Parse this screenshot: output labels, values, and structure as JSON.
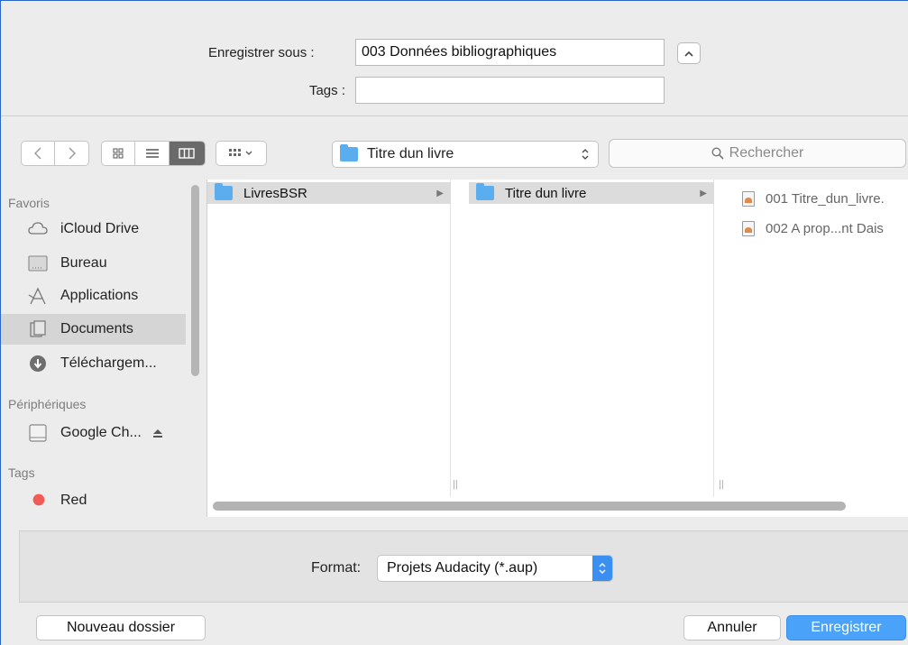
{
  "save": {
    "save_as_label": "Enregistrer sous :",
    "save_as_value": "003 Données bibliographiques",
    "tags_label": "Tags :",
    "tags_value": ""
  },
  "toolbar": {
    "location": "Titre dun livre",
    "search_placeholder": "Rechercher"
  },
  "sidebar": {
    "favorites_header": "Favoris",
    "favorites": [
      {
        "label": "iCloud Drive",
        "icon": "cloud-icon"
      },
      {
        "label": "Bureau",
        "icon": "desktop-icon"
      },
      {
        "label": "Applications",
        "icon": "applications-icon"
      },
      {
        "label": "Documents",
        "icon": "documents-icon",
        "selected": true
      },
      {
        "label": "Téléchargem...",
        "icon": "download-icon"
      }
    ],
    "devices_header": "Périphériques",
    "devices": [
      {
        "label": "Google Ch...",
        "icon": "drive-icon"
      }
    ],
    "tags_header": "Tags",
    "tags": [
      {
        "label": "Red",
        "color": "#f25a55"
      }
    ]
  },
  "columns": {
    "col1": [
      {
        "label": "LivresBSR"
      }
    ],
    "col2": [
      {
        "label": "Titre dun livre"
      }
    ],
    "col3": [
      {
        "label": "001 Titre_dun_livre."
      },
      {
        "label": "002 A prop...nt Dais"
      }
    ]
  },
  "format": {
    "label": "Format:",
    "value": "Projets Audacity (*.aup)"
  },
  "buttons": {
    "new_folder": "Nouveau dossier",
    "cancel": "Annuler",
    "save": "Enregistrer"
  }
}
